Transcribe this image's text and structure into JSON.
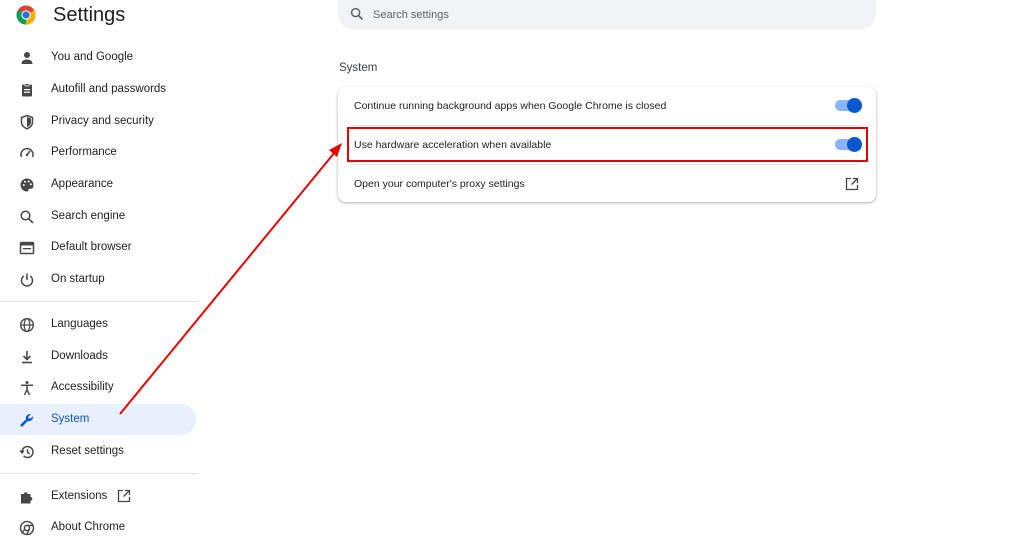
{
  "header": {
    "title": "Settings",
    "search_placeholder": "Search settings"
  },
  "sidebar": {
    "items": [
      {
        "label": "You and Google",
        "icon": "person-icon"
      },
      {
        "label": "Autofill and passwords",
        "icon": "clipboard-icon"
      },
      {
        "label": "Privacy and security",
        "icon": "shield-icon"
      },
      {
        "label": "Performance",
        "icon": "speedometer-icon"
      },
      {
        "label": "Appearance",
        "icon": "palette-icon"
      },
      {
        "label": "Search engine",
        "icon": "search-icon"
      },
      {
        "label": "Default browser",
        "icon": "browser-window-icon"
      },
      {
        "label": "On startup",
        "icon": "power-icon"
      },
      {
        "label": "Languages",
        "icon": "globe-icon"
      },
      {
        "label": "Downloads",
        "icon": "download-icon"
      },
      {
        "label": "Accessibility",
        "icon": "accessibility-icon"
      },
      {
        "label": "System",
        "icon": "wrench-icon",
        "active": true
      },
      {
        "label": "Reset settings",
        "icon": "history-icon"
      },
      {
        "label": "Extensions",
        "icon": "puzzle-icon",
        "external": true
      },
      {
        "label": "About Chrome",
        "icon": "chrome-icon"
      }
    ]
  },
  "main": {
    "section_title": "System",
    "rows": [
      {
        "label": "Continue running background apps when Google Chrome is closed",
        "control": "toggle",
        "on": true
      },
      {
        "label": "Use hardware acceleration when available",
        "control": "toggle",
        "on": true
      },
      {
        "label": "Open your computer's proxy settings",
        "control": "open-external-icon"
      }
    ]
  },
  "colors": {
    "accent": "#0b57d0",
    "active_bg": "#e8f0fe",
    "toggle_track": "#8ab4f8",
    "annotation_red": "#e60000"
  }
}
